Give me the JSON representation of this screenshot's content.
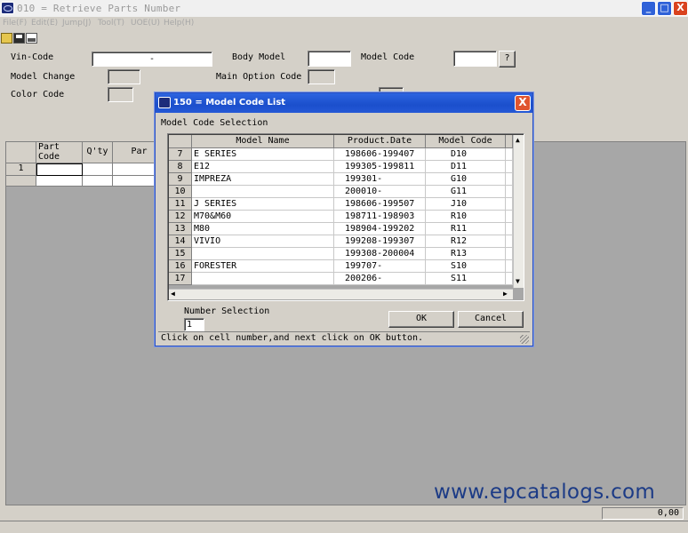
{
  "window": {
    "title": "010 = Retrieve Parts Number",
    "min_glyph": "_",
    "max_glyph": "□",
    "close_glyph": "X"
  },
  "menu": [
    {
      "label": "File(F)"
    },
    {
      "label": "Edit(E)"
    },
    {
      "label": "Jump(J)"
    },
    {
      "label": "Tool(T)"
    },
    {
      "label": "UOE(U)"
    },
    {
      "label": "Help(H)"
    }
  ],
  "form": {
    "vin_label": "Vin-Code",
    "vin_value": "-",
    "body_model_label": "Body Model",
    "body_model_value": "",
    "model_code_label": "Model Code",
    "model_code_value": "",
    "model_code_lookup": "?",
    "model_change_label": "Model Change",
    "model_change_value": "",
    "main_option_label": "Main Option Code",
    "main_option_value": "",
    "color_code_label": "Color Code",
    "color_code_value": ""
  },
  "parts_grid": {
    "headers": [
      "Part\nCode",
      "Q'ty",
      "Par"
    ],
    "row_number": "1"
  },
  "footer": {
    "watermark": "www.epcatalogs.com",
    "total": "0,00"
  },
  "dialog": {
    "title": "150 = Model Code List",
    "close_glyph": "X",
    "section_label": "Model Code Selection",
    "columns": [
      "Model Name",
      "Product.Date",
      "Model Code"
    ],
    "rows": [
      {
        "num": "7",
        "name": "E SERIES",
        "date": "198606-199407",
        "code": "D10"
      },
      {
        "num": "8",
        "name": "E12",
        "date": "199305-199811",
        "code": "D11"
      },
      {
        "num": "9",
        "name": "IMPREZA",
        "date": "199301-",
        "code": "G10"
      },
      {
        "num": "10",
        "name": "",
        "date": "200010-",
        "code": "G11"
      },
      {
        "num": "11",
        "name": "J SERIES",
        "date": "198606-199507",
        "code": "J10"
      },
      {
        "num": "12",
        "name": "M70&M60",
        "date": "198711-198903",
        "code": "R10"
      },
      {
        "num": "13",
        "name": "M80",
        "date": "198904-199202",
        "code": "R11"
      },
      {
        "num": "14",
        "name": "VIVIO",
        "date": "199208-199307",
        "code": "R12"
      },
      {
        "num": "15",
        "name": "",
        "date": "199308-200004",
        "code": "R13"
      },
      {
        "num": "16",
        "name": "FORESTER",
        "date": "199707-",
        "code": "S10"
      },
      {
        "num": "17",
        "name": "",
        "date": "200206-",
        "code": "S11"
      }
    ],
    "number_selection_label": "Number Selection",
    "number_selection_value": "1",
    "ok_label": "OK",
    "cancel_label": "Cancel",
    "status": "Click on cell number,and next click on OK button."
  }
}
